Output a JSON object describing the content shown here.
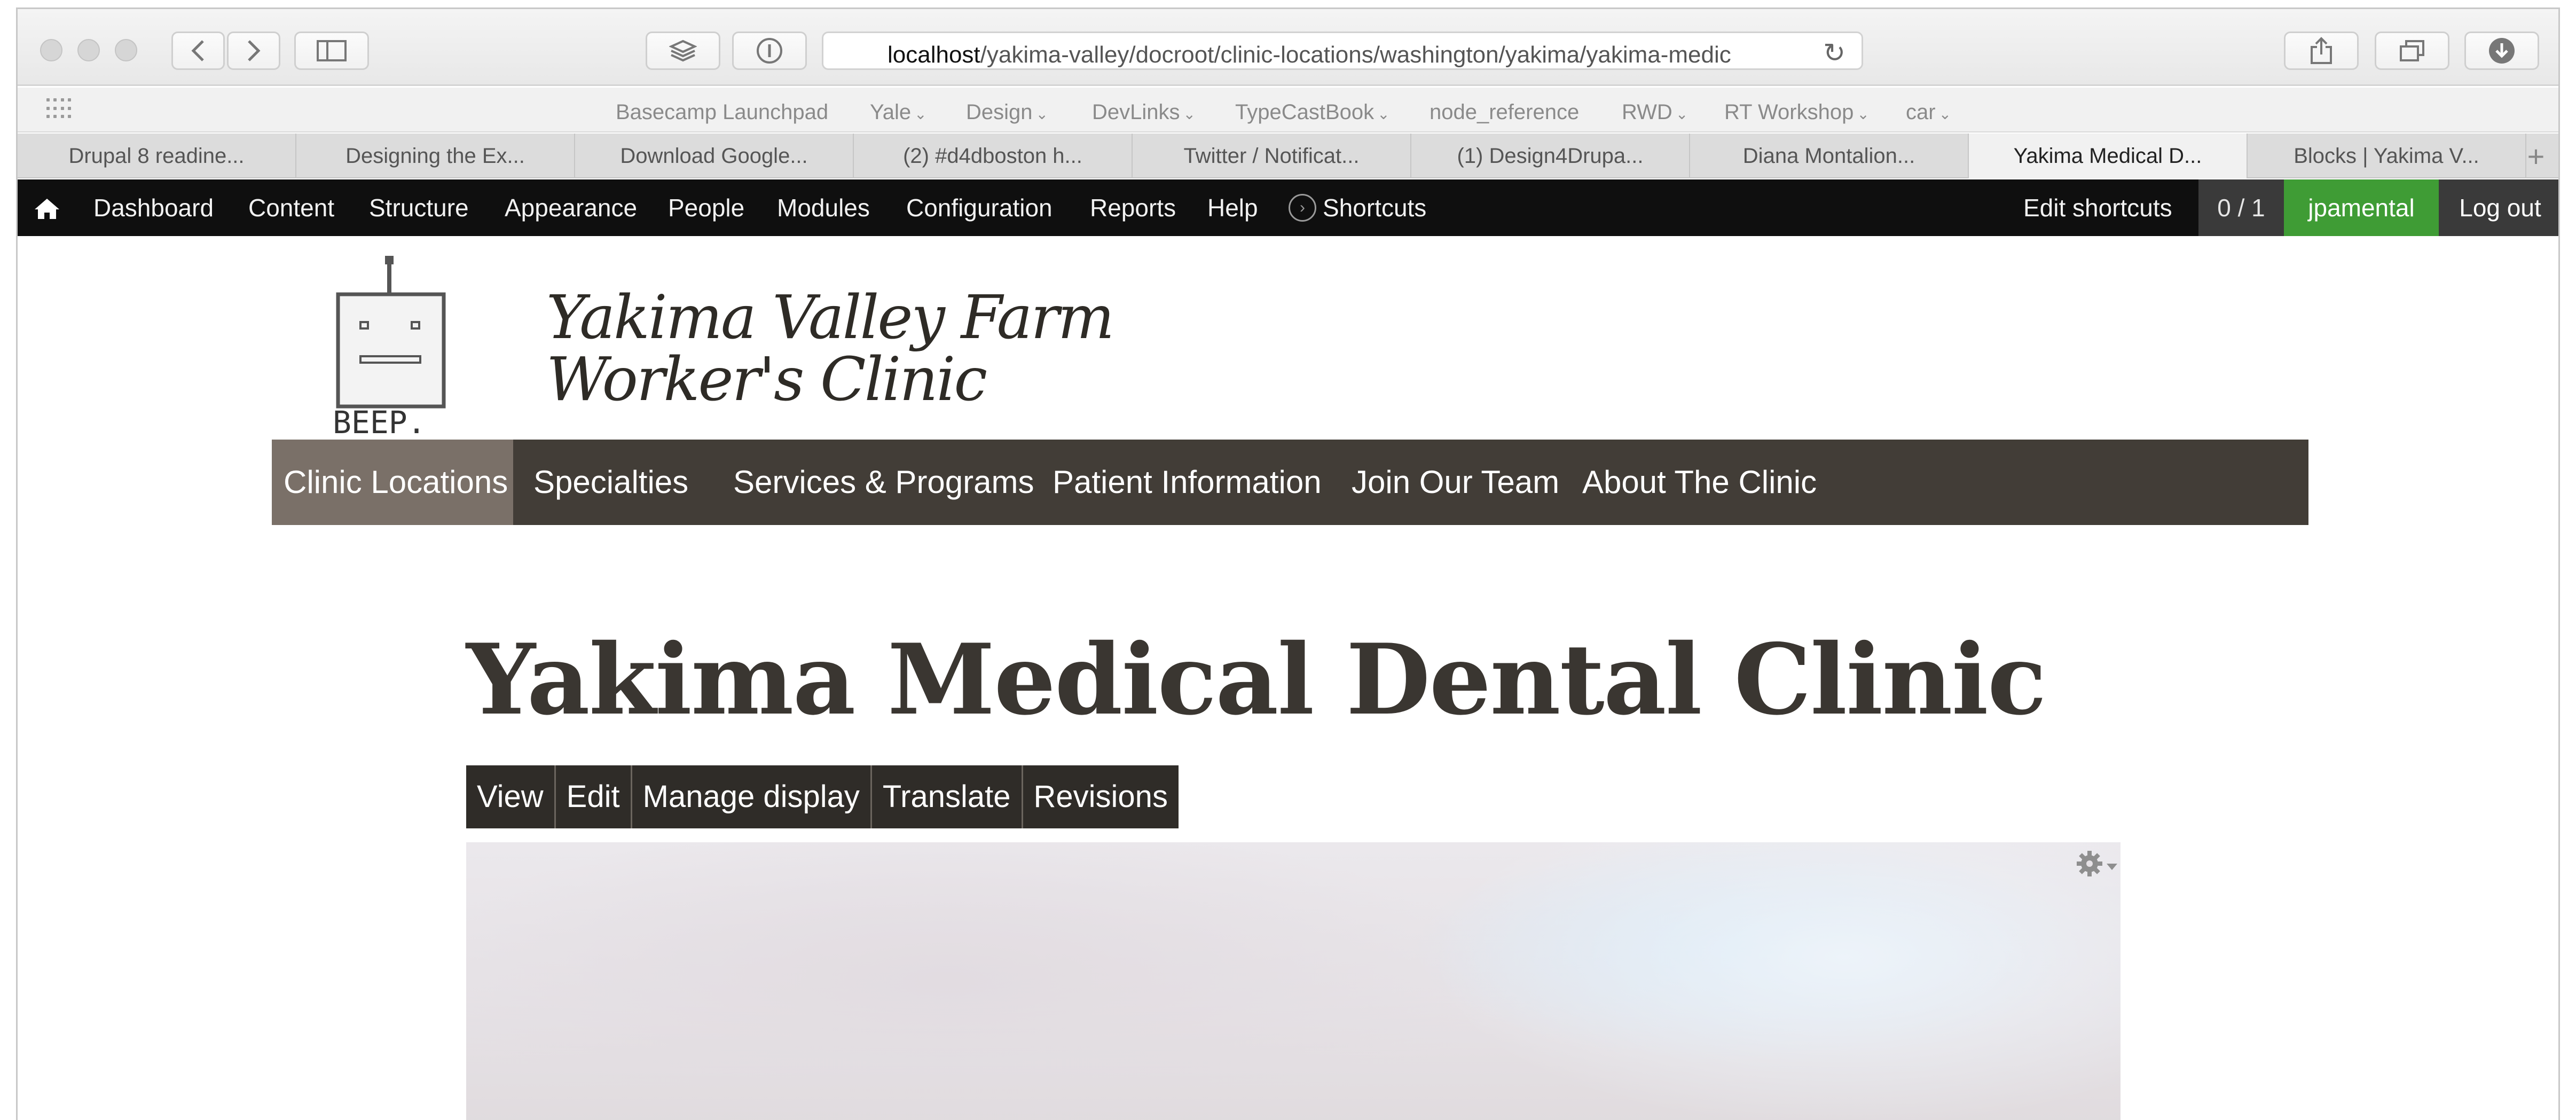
{
  "browser": {
    "url_host": "localhost",
    "url_path": "/yakima-valley/docroot/clinic-locations/washington/yakima/yakima-medic",
    "bookmarks": [
      "Basecamp Launchpad",
      "Yale",
      "Design",
      "DevLinks",
      "TypeCastBook",
      "node_reference",
      "RWD",
      "RT Workshop",
      "car"
    ],
    "bookmark_dropdown": [
      false,
      true,
      true,
      true,
      true,
      false,
      true,
      true,
      true
    ],
    "tabs": [
      "Drupal 8 readine...",
      "Designing the Ex...",
      "Download Google...",
      "(2) #d4dboston h...",
      "Twitter / Notificat...",
      "(1) Design4Drupa...",
      "Diana Montalion...",
      "Yakima Medical D...",
      "Blocks | Yakima V..."
    ],
    "active_tab_index": 7
  },
  "admin": {
    "left": [
      "Dashboard",
      "Content",
      "Structure",
      "Appearance",
      "People",
      "Modules",
      "Configuration",
      "Reports",
      "Help"
    ],
    "shortcuts": "Shortcuts",
    "edit_shortcuts": "Edit shortcuts",
    "count": "0 / 1",
    "user": "jpamental",
    "logout": "Log out"
  },
  "site": {
    "logo_text": "BEEP.",
    "name_line1": "Yakima Valley Farm",
    "name_line2": "Worker's Clinic",
    "nav": [
      "Clinic Locations",
      "Specialties",
      "Services & Programs",
      "Patient Information",
      "Join Our Team",
      "About The Clinic"
    ],
    "nav_active_index": 0
  },
  "page": {
    "title": "Yakima Medical Dental Clinic",
    "tasks": [
      "View",
      "Edit",
      "Manage display",
      "Translate",
      "Revisions"
    ]
  },
  "colors": {
    "admin_bar": "#0f0f0f",
    "user_green": "#3f9c35",
    "nav_bg": "#423d37",
    "nav_active": "#7a7068",
    "title_text": "#3a3631"
  }
}
